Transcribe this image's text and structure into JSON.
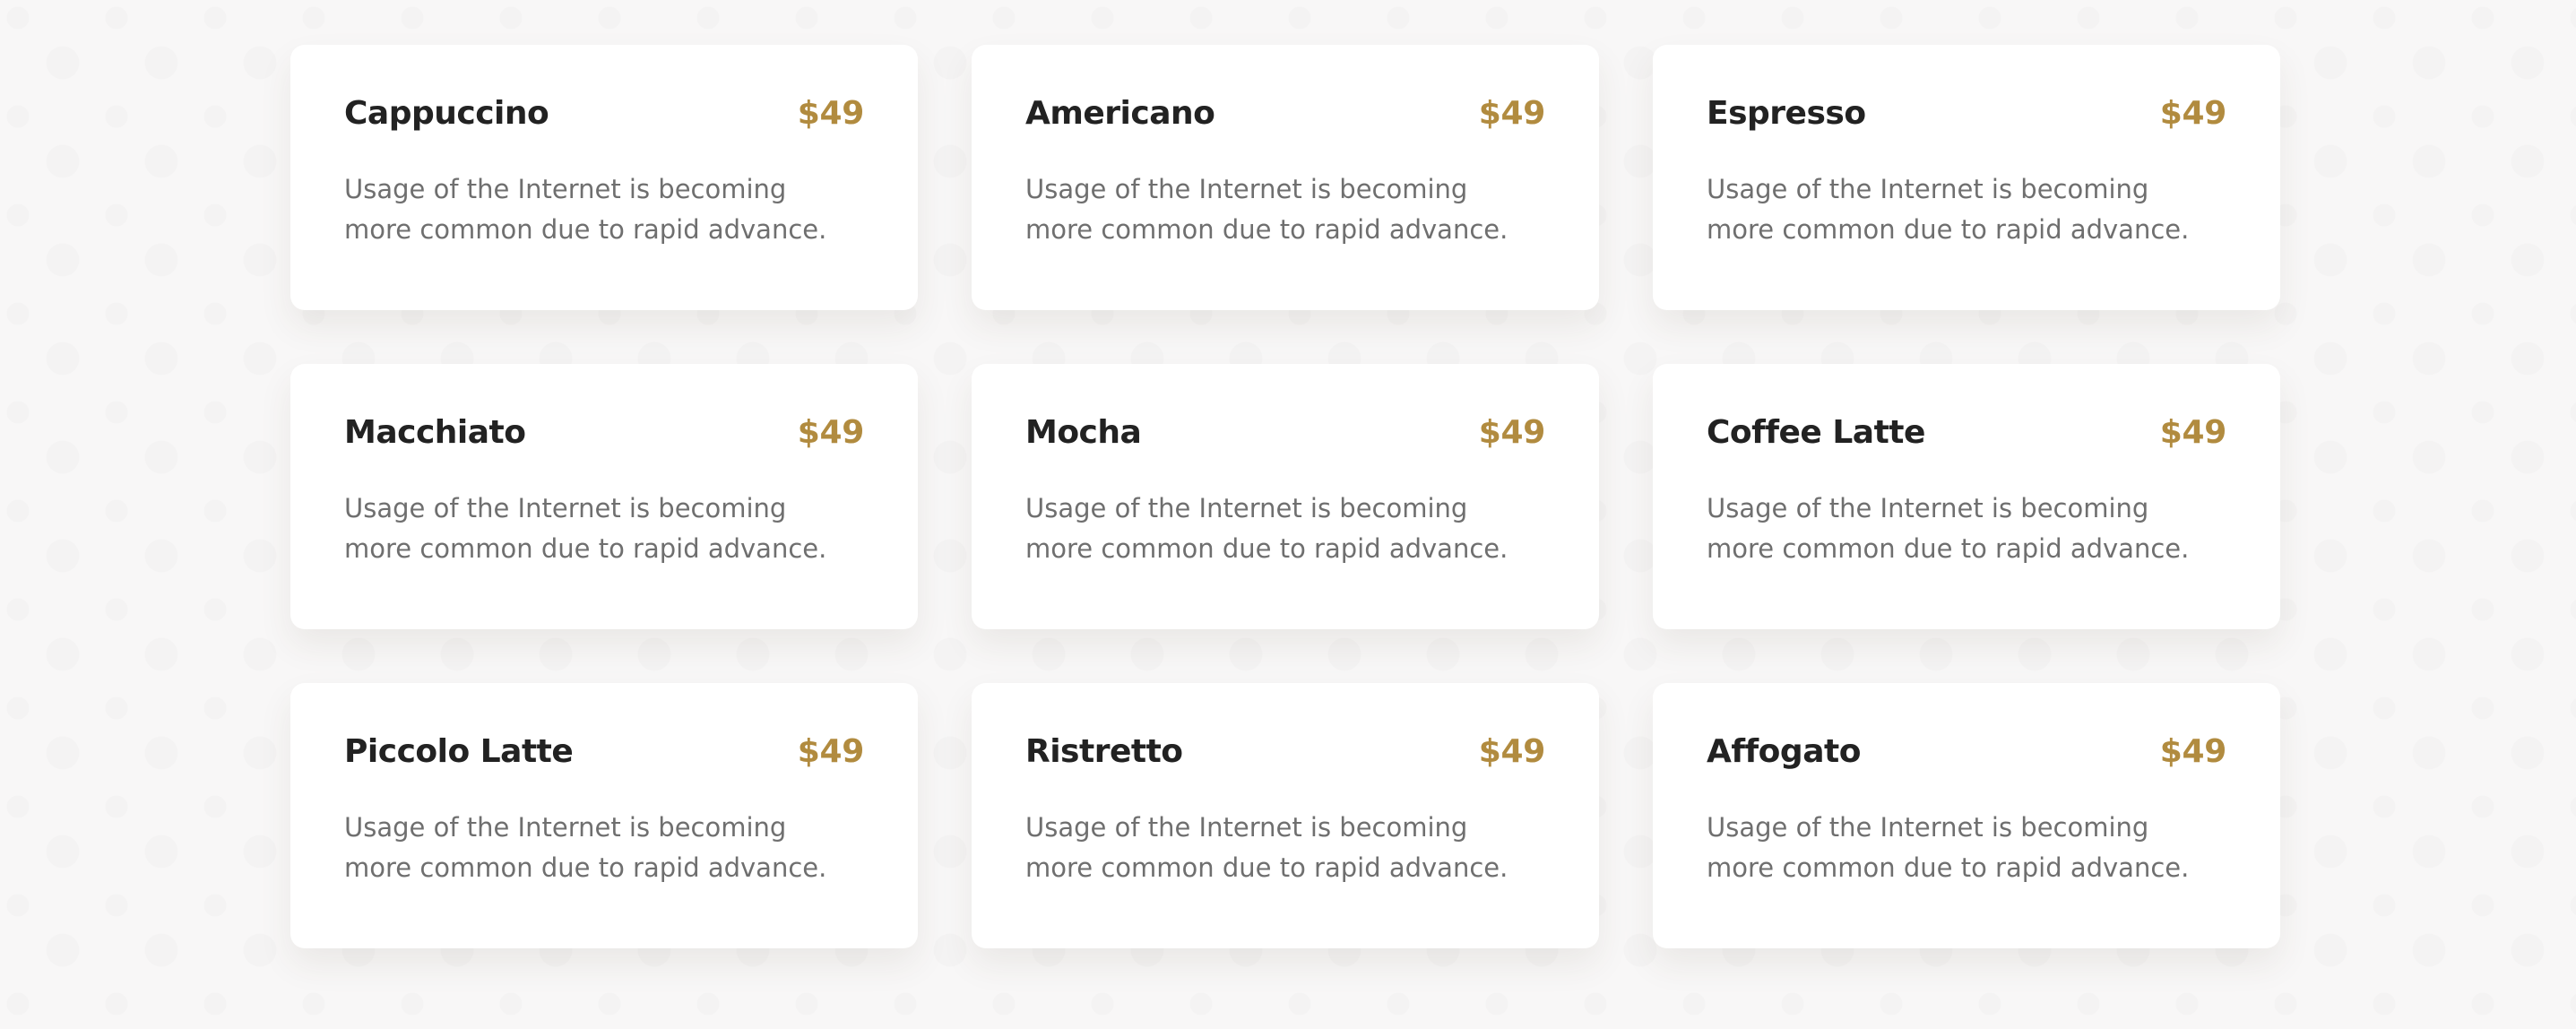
{
  "menu": {
    "items": [
      {
        "name": "Cappuccino",
        "price": "$49",
        "description": "Usage of the Internet is becoming more common due to rapid advance."
      },
      {
        "name": "Americano",
        "price": "$49",
        "description": "Usage of the Internet is becoming more common due to rapid advance."
      },
      {
        "name": "Espresso",
        "price": "$49",
        "description": "Usage of the Internet is becoming more common due to rapid advance."
      },
      {
        "name": "Macchiato",
        "price": "$49",
        "description": "Usage of the Internet is becoming more common due to rapid advance."
      },
      {
        "name": "Mocha",
        "price": "$49",
        "description": "Usage of the Internet is becoming more common due to rapid advance."
      },
      {
        "name": "Coffee Latte",
        "price": "$49",
        "description": "Usage of the Internet is becoming more common due to rapid advance."
      },
      {
        "name": "Piccolo Latte",
        "price": "$49",
        "description": "Usage of the Internet is becoming more common due to rapid advance."
      },
      {
        "name": "Ristretto",
        "price": "$49",
        "description": "Usage of the Internet is becoming more common due to rapid advance."
      },
      {
        "name": "Affogato",
        "price": "$49",
        "description": "Usage of the Internet is becoming more common due to rapid advance."
      }
    ]
  },
  "colors": {
    "accent": "#b18b3f",
    "title": "#222222",
    "text": "#6f6f6f",
    "background": "#f8f7f7",
    "card": "#ffffff"
  }
}
